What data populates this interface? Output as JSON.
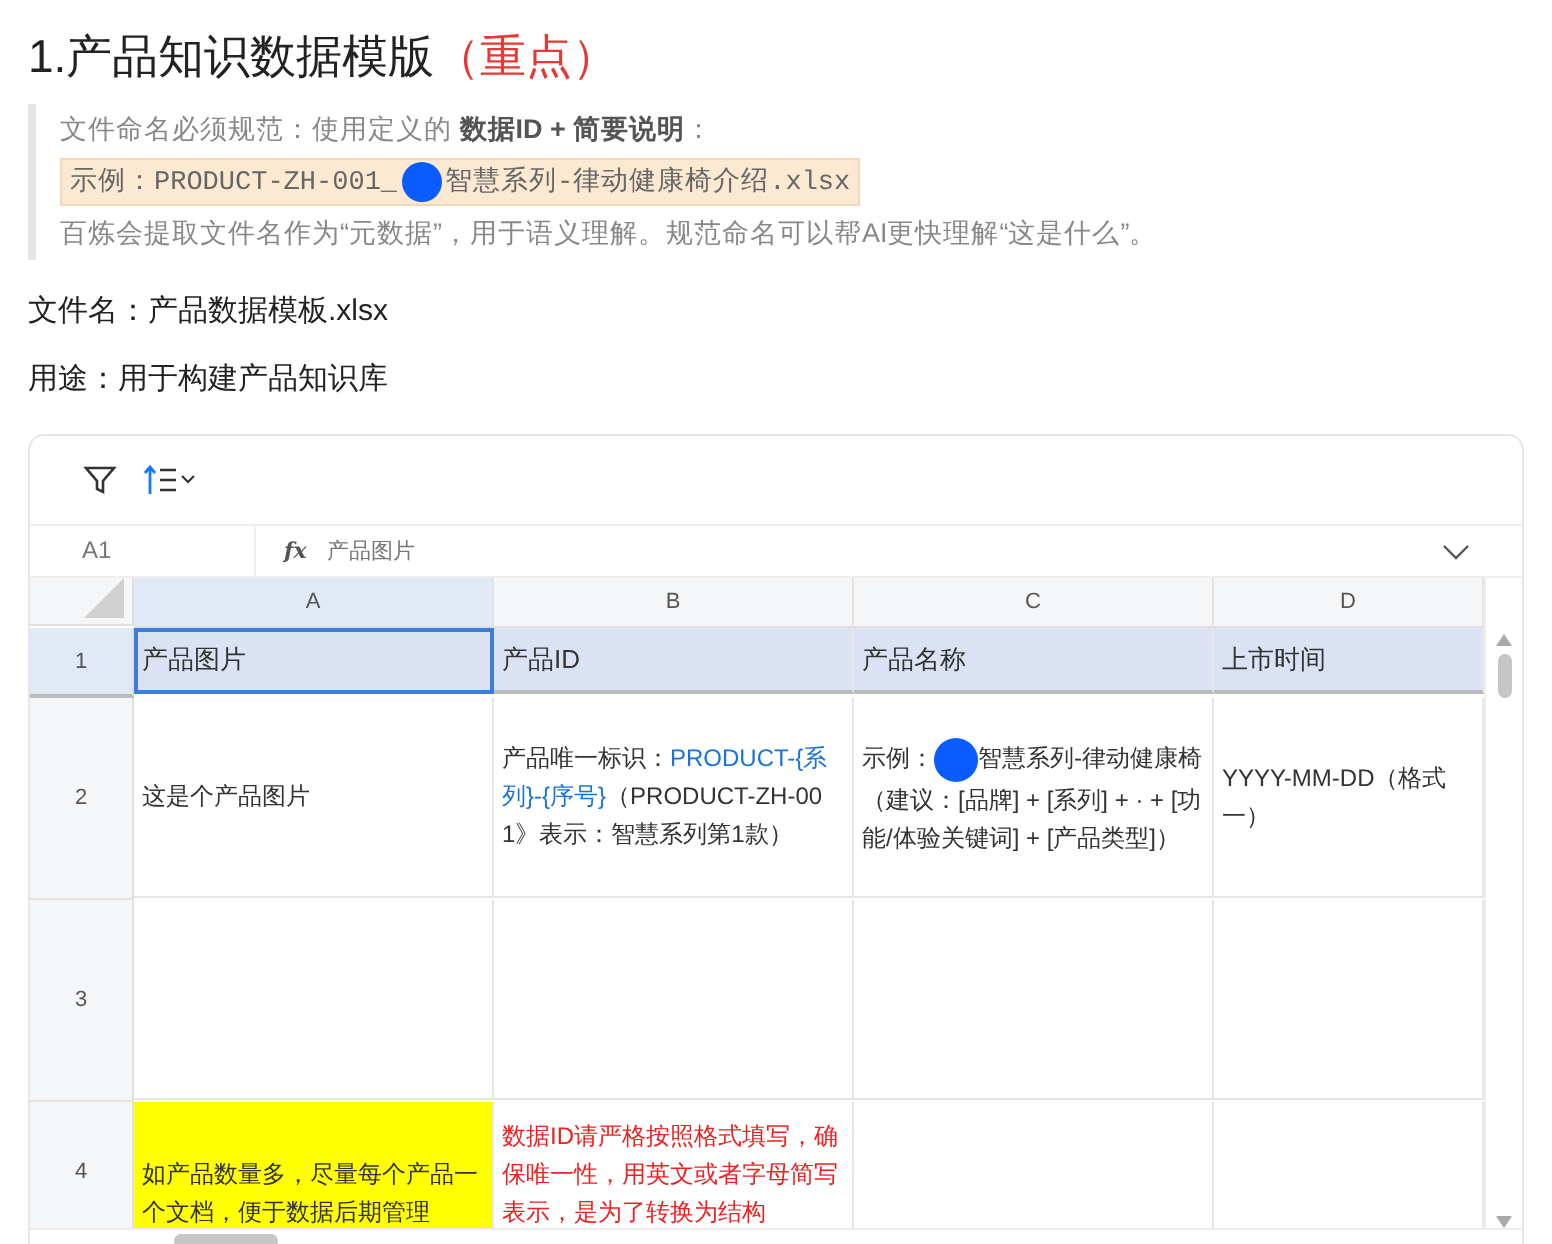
{
  "heading": {
    "title": "1.产品知识数据模版",
    "emphasis": "（重点）"
  },
  "note": {
    "rule": "文件命名必须规范：使用定义的 **数据ID + 简要说明**：",
    "example_before": "示例：PRODUCT-ZH-001_",
    "example_after": "智慧系列-律动健康椅介绍.xlsx",
    "explanation": "百炼会提取文件名作为“元数据”，用于语义理解。规范命名可以帮AI更快理解“这是什么”。"
  },
  "file_name": "文件名：产品数据模板.xlsx",
  "purpose": "用途：用于构建产品知识库",
  "sheet": {
    "name_box": "A1",
    "fx": "fx",
    "formula": "产品图片",
    "columns": [
      {
        "label": "A",
        "selected": true
      },
      {
        "label": "B",
        "selected": false
      },
      {
        "label": "C",
        "selected": false
      },
      {
        "label": "D",
        "selected": false
      }
    ],
    "rows": [
      {
        "label": "1",
        "selected": true,
        "kind": "header",
        "cells": [
          {
            "segments": [
              {
                "text": "产品图片",
                "kind": "plain"
              }
            ],
            "selected": true,
            "kind": "header"
          },
          {
            "segments": [
              {
                "text": "产品ID",
                "kind": "plain"
              }
            ],
            "selected": false,
            "kind": "header"
          },
          {
            "segments": [
              {
                "text": "产品名称",
                "kind": "plain"
              }
            ],
            "selected": false,
            "kind": "header"
          },
          {
            "segments": [
              {
                "text": "上市时间",
                "kind": "plain"
              }
            ],
            "selected": false,
            "kind": "header"
          }
        ]
      },
      {
        "label": "2",
        "selected": false,
        "kind": "tall",
        "cells": [
          {
            "segments": [
              {
                "text": "这是个产品图片",
                "kind": "plain"
              }
            ],
            "selected": false,
            "kind": "normal"
          },
          {
            "segments": [
              {
                "text": "产品唯一标识：",
                "kind": "plain"
              },
              {
                "text": "PRODUCT-{系列}-{序号}",
                "kind": "link"
              },
              {
                "text": "（PRODUCT-ZH-001》表示：智慧系列第1款）",
                "kind": "plain"
              }
            ],
            "selected": false,
            "kind": "normal"
          },
          {
            "segments": [
              {
                "text": "示例：",
                "kind": "plain"
              },
              {
                "kind": "dot"
              },
              {
                "text": "智慧系列-律动健康椅（建议：[品牌] + [系列] + · + [功能/体验关键词] + [产品类型]）",
                "kind": "plain"
              }
            ],
            "selected": false,
            "kind": "normal"
          },
          {
            "segments": [
              {
                "text": "YYYY-MM-DD（格式一）",
                "kind": "plain"
              }
            ],
            "selected": false,
            "kind": "normal"
          }
        ]
      },
      {
        "label": "3",
        "selected": false,
        "kind": "tall",
        "cells": [
          {
            "selected": false,
            "kind": "normal"
          },
          {
            "selected": false,
            "kind": "normal"
          },
          {
            "selected": false,
            "kind": "normal"
          },
          {
            "selected": false,
            "kind": "normal"
          }
        ]
      },
      {
        "label": "4",
        "selected": false,
        "kind": "cut",
        "cells": [
          {
            "segments": [
              {
                "text": "如产品数量多，尽量每个产品一个文档，便于数据后期管理",
                "kind": "plain"
              }
            ],
            "selected": false,
            "kind": "highlight"
          },
          {
            "segments": [
              {
                "text": "数据ID请严格按照格式填写，确保唯一性，用英文或者字母简写表示，是为了转换为结构",
                "kind": "plain"
              }
            ],
            "selected": false,
            "kind": "warning"
          },
          {
            "selected": false,
            "kind": "normal"
          },
          {
            "selected": false,
            "kind": "normal"
          }
        ]
      }
    ]
  }
}
